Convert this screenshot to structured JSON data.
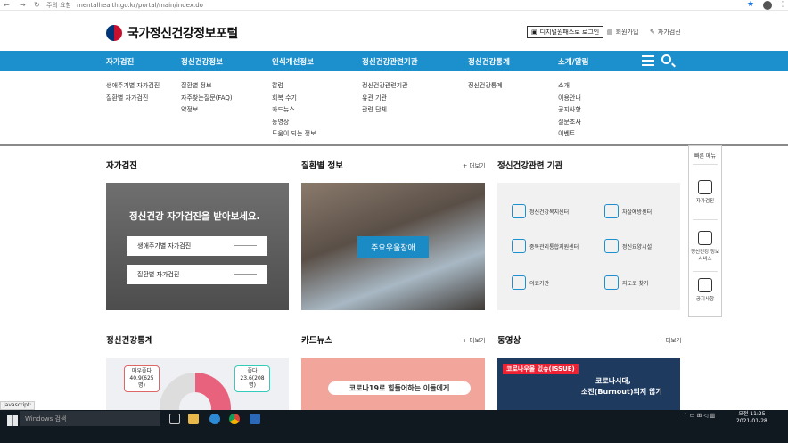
{
  "browser": {
    "insecure_label": "주의 요함",
    "url": "mentalhealth.go.kr/portal/main/index.do"
  },
  "header": {
    "site_title": "국가정신건강정보포털",
    "login_btn": "디지털원패스로 로그인",
    "signup": "회원가입",
    "self_check": "자가검진"
  },
  "gnb": [
    "자가검진",
    "정신건강정보",
    "인식개선정보",
    "정신건강관련기관",
    "정신건강통계",
    "소개/알림"
  ],
  "submenu": {
    "col1": [
      "생애주기별 자가검진",
      "질환별 자가검진"
    ],
    "col2": [
      "질환별 정보",
      "자주찾는질문(FAQ)",
      "약정보"
    ],
    "col3": [
      "칼럼",
      "회복 수기",
      "카드뉴스",
      "동영상",
      "도움이 되는 정보"
    ],
    "col4": [
      "정신건강관련기관",
      "유관 기관",
      "관련 단체"
    ],
    "col5": [
      "정신건강통계"
    ],
    "col6": [
      "소개",
      "이용안내",
      "공지사항",
      "설문조사",
      "이벤트"
    ]
  },
  "sections": {
    "self_check": {
      "title": "자가검진",
      "headline": "정신건강 자가검진을 받아보세요.",
      "btn1": "생애주기별 자가검진",
      "btn2": "질환별 자가검진"
    },
    "disease": {
      "title": "질환별 정보",
      "more": "+ 더보기",
      "badge": "주요우울장애"
    },
    "institutions": {
      "title": "정신건강관련 기관",
      "items": [
        "정신건강복지센터",
        "자살예방센터",
        "중독관리통합지원센터",
        "정신요양시설",
        "의료기관",
        "지도로 찾기"
      ]
    },
    "stats": {
      "title": "정신건강통계",
      "tag1": "매우좋다 40.9(625명)",
      "tag2": "좋다 23.6(208명)"
    },
    "cardnews": {
      "title": "카드뉴스",
      "more": "+ 더보기",
      "text": "코로나19로 힘들어하는 이들에게"
    },
    "video": {
      "title": "동영상",
      "more": "+ 더보기",
      "text1": "코로나우울 있슈(ISSUE)",
      "text2": "코로나시대,",
      "text3": "소진(Burnout)되지 않기"
    }
  },
  "quick_menu": {
    "title": "빠른 메뉴",
    "items": [
      "자가검진",
      "정신건강 정보서비스",
      "공지사항"
    ]
  },
  "taskbar": {
    "status": "javascript:",
    "search": "Windows 검색",
    "time": "오전 11:25",
    "date": "2021-01-28"
  }
}
